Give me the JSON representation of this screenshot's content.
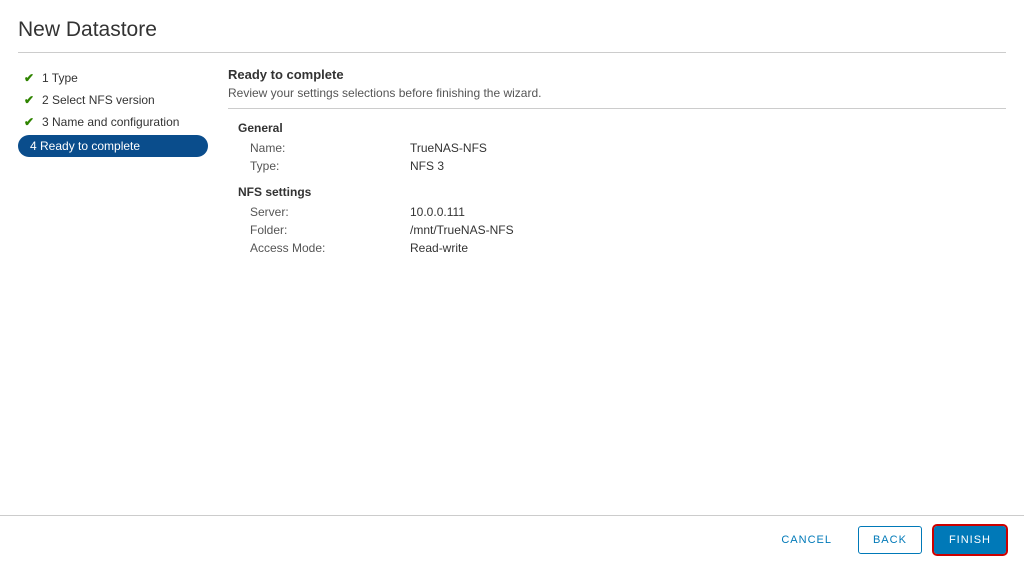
{
  "title": "New Datastore",
  "steps": [
    {
      "label": "1 Type",
      "completed": true,
      "active": false
    },
    {
      "label": "2 Select NFS version",
      "completed": true,
      "active": false
    },
    {
      "label": "3 Name and configuration",
      "completed": true,
      "active": false
    },
    {
      "label": "4 Ready to complete",
      "completed": false,
      "active": true
    }
  ],
  "panel": {
    "heading": "Ready to complete",
    "subheading": "Review your settings selections before finishing the wizard."
  },
  "sections": [
    {
      "title": "General",
      "rows": [
        {
          "label": "Name:",
          "value": "TrueNAS-NFS"
        },
        {
          "label": "Type:",
          "value": "NFS 3"
        }
      ]
    },
    {
      "title": "NFS settings",
      "rows": [
        {
          "label": "Server:",
          "value": "10.0.0.111"
        },
        {
          "label": "Folder:",
          "value": "/mnt/TrueNAS-NFS"
        },
        {
          "label": "Access Mode:",
          "value": "Read-write"
        }
      ]
    }
  ],
  "footer": {
    "cancel": "CANCEL",
    "back": "BACK",
    "finish": "FINISH"
  }
}
